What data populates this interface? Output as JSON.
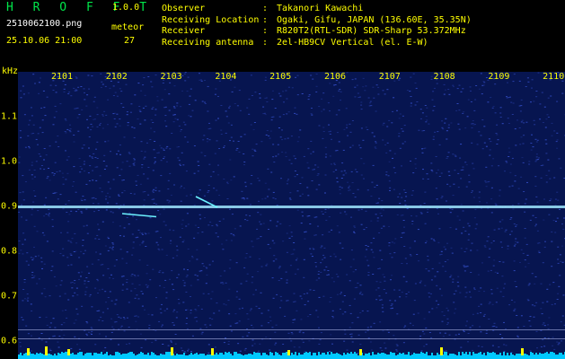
{
  "header": {
    "app_title": "H R O F F T",
    "app_version": "1.0.0",
    "file_name": "2510062100.png",
    "meteor_label": "meteor",
    "date_time": "25.10.06 21:00",
    "meteor_count": "27"
  },
  "info": {
    "observer": {
      "label": "Observer",
      "value": "Takanori Kawachi"
    },
    "location": {
      "label": "Receiving Location",
      "value": "Ogaki, Gifu, JAPAN (136.60E, 35.35N)"
    },
    "receiver": {
      "label": "Receiver",
      "value": "R820T2(RTL-SDR) SDR-Sharp 53.372MHz"
    },
    "antenna": {
      "label": "Receiving antenna",
      "value": "2el-HB9CV Vertical (el. E-W)"
    },
    "separator": ":"
  },
  "chart_data": {
    "type": "heatmap",
    "ylabel": "kHz",
    "x_ticks": [
      "2101",
      "2102",
      "2103",
      "2104",
      "2105",
      "2106",
      "2107",
      "2108",
      "2109",
      "2110"
    ],
    "y_ticks": [
      "1.1",
      "1.0",
      "0.9",
      "0.8",
      "0.7",
      "0.6"
    ],
    "carrier_khz": 0.9,
    "colors": {
      "background": "#071550",
      "noise": "#3a56d8",
      "carrier": "#9fe8ff",
      "meteor": "#6cf2ff",
      "bar_base": "#00c8ff",
      "bar_peak": "#ffff00",
      "labels": "#ffff00",
      "title": "#00e64a"
    }
  }
}
